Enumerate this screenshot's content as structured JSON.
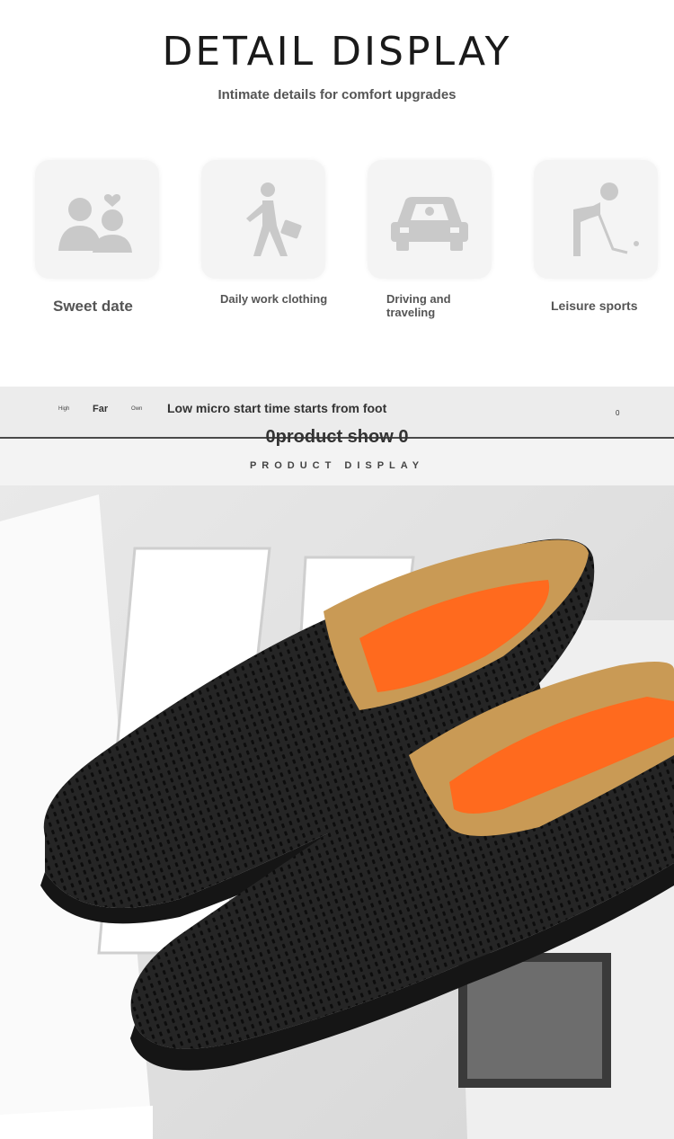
{
  "header": {
    "title": "DETAIL DISPLAY",
    "subtitle": "Intimate details for comfort upgrades"
  },
  "scenarios": [
    {
      "label": "Sweet date",
      "icon": "couple-heart-icon"
    },
    {
      "label": "Daily work clothing",
      "icon": "walking-briefcase-icon"
    },
    {
      "label": "Driving and traveling",
      "icon": "car-icon"
    },
    {
      "label": "Leisure sports",
      "icon": "golfer-icon"
    }
  ],
  "nav": {
    "high": "High",
    "far": "Far",
    "own": "Own",
    "text": "Low micro start time starts from foot",
    "counter": "0"
  },
  "product": {
    "heading": "0product show 0",
    "subheading": "PRODUCT DISPLAY",
    "image_icon": "black-perforated-loafers-photo",
    "colors": {
      "leather": "#1f1f1f",
      "insole": "#ff6a1e",
      "lining": "#c99a55"
    }
  }
}
